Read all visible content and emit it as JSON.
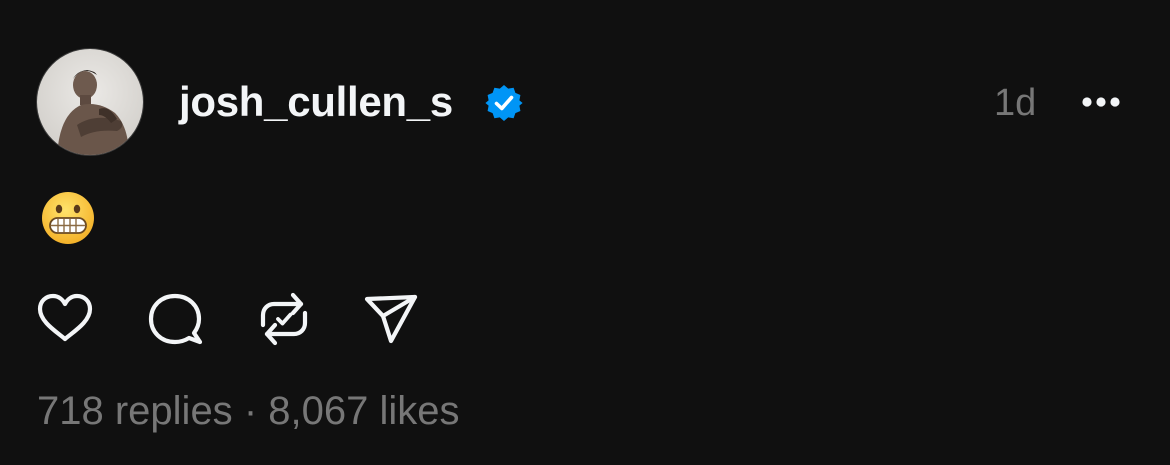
{
  "post": {
    "author": {
      "username": "josh_cullen_s",
      "verified": true,
      "avatar_icon": "profile-photo"
    },
    "timestamp": "1d",
    "content_emoji": "grimacing-face-emoji",
    "stats": {
      "replies": "718 replies",
      "separator": "·",
      "likes": "8,067 likes"
    }
  },
  "actions": [
    "heart-icon",
    "comment-icon",
    "repost-icon",
    "share-icon"
  ],
  "colors": {
    "background": "#101010",
    "text": "#f3f5f7",
    "muted": "#777777",
    "verified": "#0095f6"
  }
}
